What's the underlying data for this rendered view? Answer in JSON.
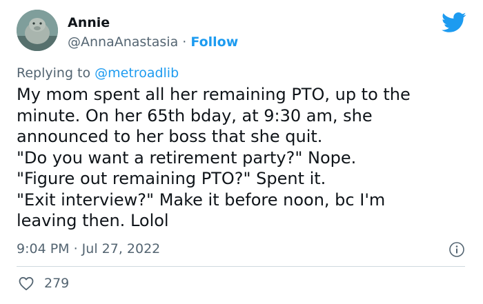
{
  "author": {
    "display_name": "Annie",
    "handle": "@AnnaAnastasia",
    "separator": " · ",
    "follow_label": "Follow"
  },
  "reply": {
    "prefix": "Replying to ",
    "mention": "@metroadlib"
  },
  "tweet": {
    "lines": [
      "My mom spent all her remaining PTO, up to the",
      "minute. On her 65th bday, at 9:30 am, she",
      "announced to her boss that she quit.",
      "\"Do you want a retirement party?\" Nope.",
      "\"Figure out remaining PTO?\" Spent it.",
      "\"Exit interview?\" Make it before noon, bc I'm",
      "leaving then. Lolol"
    ]
  },
  "meta": {
    "timestamp": "9:04 PM · Jul 27, 2022"
  },
  "engagement": {
    "likes": "279"
  },
  "icons": {
    "brand": "twitter-bird-icon",
    "info": "info-icon",
    "like": "heart-icon"
  },
  "colors": {
    "accent": "#1d9bf0",
    "secondary_text": "#536471",
    "primary_text": "#0f1419"
  }
}
